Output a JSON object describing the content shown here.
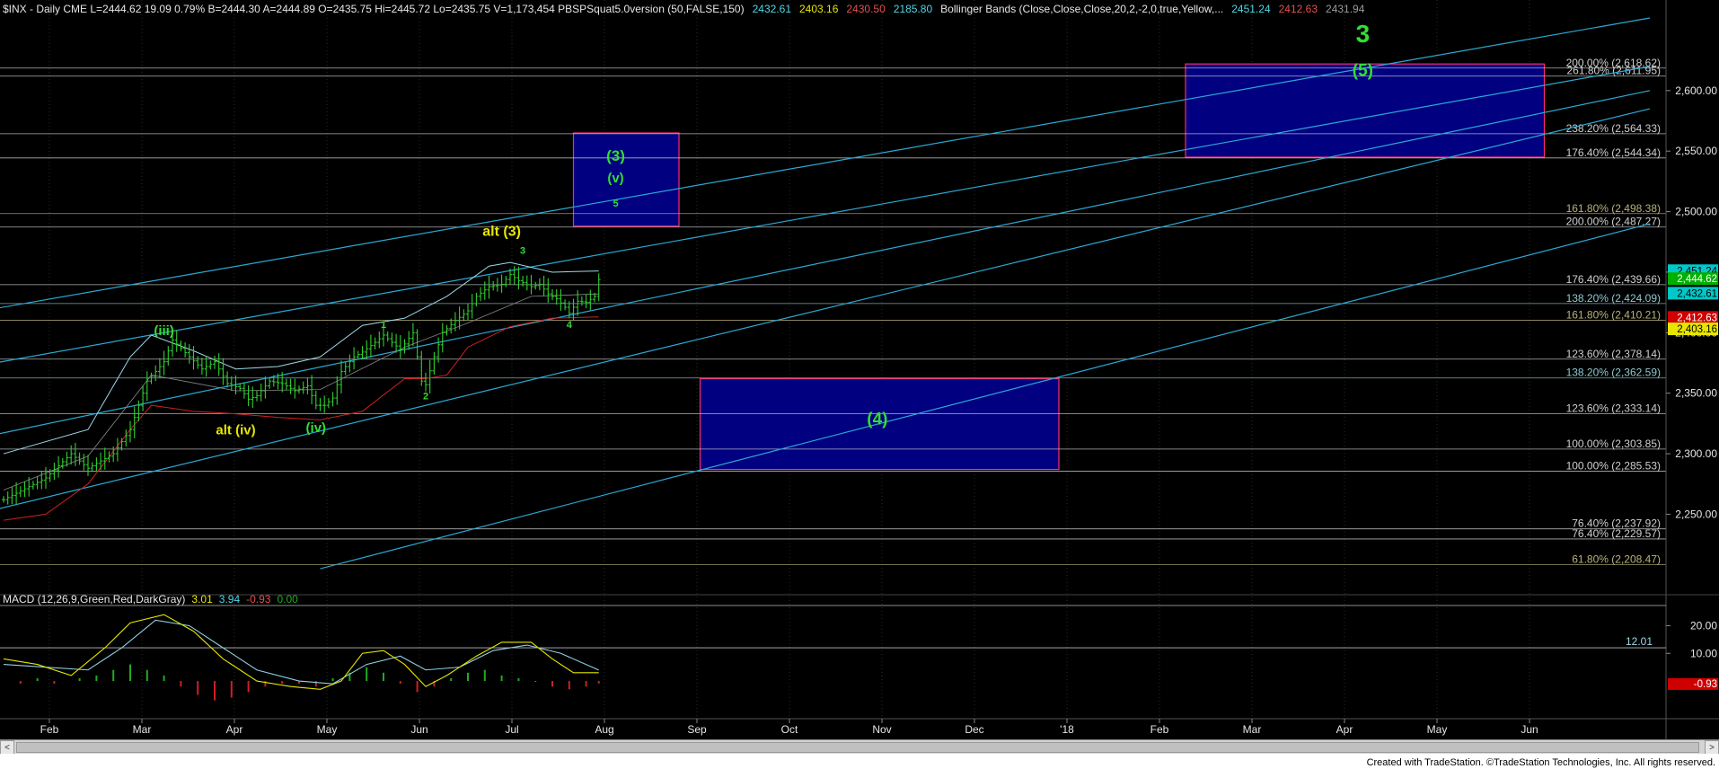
{
  "header": {
    "parts": [
      {
        "text": "$INX - Daily  CME   L=2444.62  19.09  0.79%   B=2444.30   A=2444.89   O=2435.75   Hi=2445.72   Lo=2435.75   V=1,173,454   PBSPSquat5.0version (50,FALSE,150)",
        "color": "#e6e6e6"
      },
      {
        "text": "2432.61",
        "color": "#4fd6e6"
      },
      {
        "text": "2403.16",
        "color": "#e6e600"
      },
      {
        "text": "2430.50",
        "color": "#e05050"
      },
      {
        "text": "2185.80",
        "color": "#4fd6e6"
      },
      {
        "text": "Bollinger Bands (Close,Close,Close,20,2,-2,0,true,Yellow,...",
        "color": "#e6e6e6"
      },
      {
        "text": "2451.24",
        "color": "#4fd6e6"
      },
      {
        "text": "2412.63",
        "color": "#e05050"
      },
      {
        "text": "2431.94",
        "color": "#9a9a9a"
      }
    ]
  },
  "macd_header": {
    "parts": [
      {
        "text": "MACD (12,26,9,Green,Red,DarkGray)",
        "color": "#e6e6e6"
      },
      {
        "text": "3.01",
        "color": "#e6e600"
      },
      {
        "text": "3.94",
        "color": "#4fd6e6"
      },
      {
        "text": "-0.93",
        "color": "#e05050"
      },
      {
        "text": "0.00",
        "color": "#22aa22"
      }
    ]
  },
  "footer": {
    "credit": "Created with TradeStation. ©TradeStation Technologies, Inc. All rights reserved."
  },
  "chart_data": [
    {
      "type": "candlestick",
      "symbol": "$INX",
      "timeframe": "Daily",
      "ylim": [
        2185,
        2660
      ],
      "y_ticks": [
        2250,
        2300,
        2350,
        2400,
        2450,
        2500,
        2550,
        2600
      ],
      "x_ticks": [
        "Feb",
        "Mar",
        "Apr",
        "May",
        "Jun",
        "Jul",
        "Aug",
        "Sep",
        "Oct",
        "Nov",
        "Dec",
        "'18",
        "Feb",
        "Mar",
        "Apr",
        "May",
        "Jun"
      ],
      "last_price": 2444.62,
      "price_path": [
        [
          0,
          2262
        ],
        [
          10,
          2280
        ],
        [
          16,
          2300
        ],
        [
          20,
          2288
        ],
        [
          26,
          2300
        ],
        [
          30,
          2320
        ],
        [
          34,
          2360
        ],
        [
          38,
          2376
        ],
        [
          40,
          2394
        ],
        [
          44,
          2380
        ],
        [
          47,
          2370
        ],
        [
          50,
          2376
        ],
        [
          53,
          2358
        ],
        [
          56,
          2354
        ],
        [
          58,
          2345
        ],
        [
          60,
          2348
        ],
        [
          63,
          2360
        ],
        [
          66,
          2358
        ],
        [
          69,
          2352
        ],
        [
          72,
          2356
        ],
        [
          74,
          2340
        ],
        [
          76,
          2340
        ],
        [
          78,
          2346
        ],
        [
          80,
          2368
        ],
        [
          83,
          2380
        ],
        [
          85,
          2384
        ],
        [
          88,
          2392
        ],
        [
          90,
          2398
        ],
        [
          92,
          2392
        ],
        [
          94,
          2386
        ],
        [
          97,
          2400
        ],
        [
          99,
          2360
        ],
        [
          100,
          2357
        ],
        [
          102,
          2380
        ],
        [
          104,
          2400
        ],
        [
          107,
          2410
        ],
        [
          110,
          2418
        ],
        [
          112,
          2430
        ],
        [
          115,
          2438
        ],
        [
          118,
          2440
        ],
        [
          120,
          2448
        ],
        [
          122,
          2443
        ],
        [
          125,
          2438
        ],
        [
          127,
          2440
        ],
        [
          129,
          2432
        ],
        [
          131,
          2428
        ],
        [
          133,
          2421
        ],
        [
          134,
          2416
        ],
        [
          136,
          2426
        ],
        [
          138,
          2425
        ],
        [
          140,
          2430
        ],
        [
          141,
          2444
        ]
      ],
      "bollinger_upper": [
        [
          0,
          2300
        ],
        [
          20,
          2320
        ],
        [
          30,
          2380
        ],
        [
          35,
          2398
        ],
        [
          45,
          2385
        ],
        [
          55,
          2370
        ],
        [
          65,
          2372
        ],
        [
          75,
          2380
        ],
        [
          85,
          2406
        ],
        [
          95,
          2412
        ],
        [
          105,
          2430
        ],
        [
          115,
          2455
        ],
        [
          120,
          2458
        ],
        [
          130,
          2450
        ],
        [
          141,
          2451
        ]
      ],
      "bollinger_lower": [
        [
          0,
          2245
        ],
        [
          10,
          2250
        ],
        [
          20,
          2275
        ],
        [
          30,
          2320
        ],
        [
          35,
          2340
        ],
        [
          45,
          2335
        ],
        [
          55,
          2333
        ],
        [
          65,
          2330
        ],
        [
          75,
          2328
        ],
        [
          85,
          2335
        ],
        [
          95,
          2362
        ],
        [
          100,
          2362
        ],
        [
          105,
          2365
        ],
        [
          110,
          2388
        ],
        [
          120,
          2405
        ],
        [
          130,
          2412
        ],
        [
          141,
          2413
        ]
      ],
      "bollinger_mid": [
        [
          0,
          2270
        ],
        [
          20,
          2298
        ],
        [
          35,
          2365
        ],
        [
          55,
          2352
        ],
        [
          75,
          2353
        ],
        [
          95,
          2388
        ],
        [
          110,
          2408
        ],
        [
          125,
          2430
        ],
        [
          141,
          2432
        ]
      ],
      "channel_lines": [
        {
          "p1": [
            -10,
            2415
          ],
          "p2": [
            390,
            2660
          ]
        },
        {
          "p1": [
            -10,
            2370
          ],
          "p2": [
            390,
            2620
          ]
        },
        {
          "p1": [
            -10,
            2310
          ],
          "p2": [
            390,
            2600
          ]
        },
        {
          "p1": [
            -10,
            2247
          ],
          "p2": [
            390,
            2585
          ]
        },
        {
          "p1": [
            75,
            2205
          ],
          "p2": [
            390,
            2490
          ]
        }
      ],
      "boxes": [
        {
          "x": [
            135,
            160
          ],
          "y": [
            2488,
            2565
          ],
          "label": "(3) (v) 5"
        },
        {
          "x": [
            165,
            250
          ],
          "y": [
            2287,
            2362
          ],
          "label": "(4)"
        },
        {
          "x": [
            280,
            365
          ],
          "y": [
            2545,
            2622
          ],
          "label": "3 (5)"
        }
      ],
      "fib_levels": [
        {
          "value": 2618.62,
          "label": "200.00% (2,618.62)",
          "color": "#cfcfcf"
        },
        {
          "value": 2611.95,
          "label": "261.80% (2,611.95)",
          "color": "#cfcfcf"
        },
        {
          "value": 2564.33,
          "label": "238.20% (2,564.33)",
          "color": "#cfcfcf"
        },
        {
          "value": 2544.34,
          "label": "176.40% (2,544.34)",
          "color": "#cfcfcf"
        },
        {
          "value": 2498.38,
          "label": "161.80% (2,498.38)",
          "color": "#b8b27a"
        },
        {
          "value": 2487.27,
          "label": "200.00% (2,487.27)",
          "color": "#cfcfcf"
        },
        {
          "value": 2439.66,
          "label": "176.40% (2,439.66)",
          "color": "#cfcfcf"
        },
        {
          "value": 2424.09,
          "label": "138.20% (2,424.09)",
          "color": "#8fc8d0"
        },
        {
          "value": 2410.21,
          "label": "161.80% (2,410.21)",
          "color": "#b8b27a"
        },
        {
          "value": 2378.14,
          "label": "123.60% (2,378.14)",
          "color": "#cfcfcf"
        },
        {
          "value": 2362.59,
          "label": "138.20% (2,362.59)",
          "color": "#8fc8d0"
        },
        {
          "value": 2333.14,
          "label": "123.60% (2,333.14)",
          "color": "#cfcfcf"
        },
        {
          "value": 2303.85,
          "label": "100.00% (2,303.85)",
          "color": "#cfcfcf"
        },
        {
          "value": 2285.53,
          "label": "100.00% (2,285.53)",
          "color": "#cfcfcf"
        },
        {
          "value": 2237.92,
          "label": "76.40% (2,237.92)",
          "color": "#cfcfcf"
        },
        {
          "value": 2229.57,
          "label": "76.40% (2,229.57)",
          "color": "#cfcfcf"
        },
        {
          "value": 2208.47,
          "label": "61.80% (2,208.47)",
          "color": "#b8b27a"
        }
      ],
      "price_tags": [
        {
          "text": "2,451.24",
          "value": 2451.24,
          "bg": "#00c8c8",
          "fg": "#000000"
        },
        {
          "text": "2,444.62",
          "value": 2444.62,
          "bg": "#00b000",
          "fg": "#ffffff"
        },
        {
          "text": "2,432.61",
          "value": 2432.61,
          "bg": "#00c8c8",
          "fg": "#000000"
        },
        {
          "text": "2,412.63",
          "value": 2412.63,
          "bg": "#d00000",
          "fg": "#ffffff"
        },
        {
          "text": "2,403.16",
          "value": 2403.16,
          "bg": "#e6e600",
          "fg": "#000000"
        }
      ],
      "wave_labels": [
        {
          "text": "(iii)",
          "x": 38,
          "y": 2398,
          "color": "#33dd33",
          "size": 15
        },
        {
          "text": "alt (iv)",
          "x": 55,
          "y": 2316,
          "color": "#e6e600",
          "size": 15
        },
        {
          "text": "(iv)",
          "x": 74,
          "y": 2318,
          "color": "#33dd33",
          "size": 15
        },
        {
          "text": "1",
          "x": 90,
          "y": 2404,
          "color": "#33dd33",
          "size": 11
        },
        {
          "text": "2",
          "x": 100,
          "y": 2345,
          "color": "#33dd33",
          "size": 11
        },
        {
          "text": "alt (3)",
          "x": 118,
          "y": 2480,
          "color": "#e6e600",
          "size": 16
        },
        {
          "text": "3",
          "x": 123,
          "y": 2465,
          "color": "#33dd33",
          "size": 11
        },
        {
          "text": "4",
          "x": 134,
          "y": 2404,
          "color": "#33dd33",
          "size": 11
        },
        {
          "text": "(3)",
          "x": 145,
          "y": 2542,
          "color": "#33dd33",
          "size": 17
        },
        {
          "text": "(v)",
          "x": 145,
          "y": 2524,
          "color": "#33dd33",
          "size": 15
        },
        {
          "text": "5",
          "x": 145,
          "y": 2504,
          "color": "#33dd33",
          "size": 11
        },
        {
          "text": "(4)",
          "x": 207,
          "y": 2324,
          "color": "#33dd33",
          "size": 19
        },
        {
          "text": "3",
          "x": 322,
          "y": 2640,
          "color": "#33dd33",
          "size": 28
        },
        {
          "text": "(5)",
          "x": 322,
          "y": 2612,
          "color": "#33dd33",
          "size": 19
        }
      ]
    },
    {
      "type": "macd",
      "title": "MACD (12,26,9,Green,Red,DarkGray)",
      "ylim": [
        -12,
        26
      ],
      "y_ticks": [
        20,
        10
      ],
      "reference_line": {
        "value": 12.01,
        "label": "12.01"
      },
      "last_histogram_tag": "-0.93",
      "macd": [
        [
          0,
          8
        ],
        [
          8,
          6
        ],
        [
          16,
          2
        ],
        [
          24,
          12
        ],
        [
          30,
          21
        ],
        [
          38,
          24
        ],
        [
          45,
          18
        ],
        [
          52,
          8
        ],
        [
          60,
          0
        ],
        [
          68,
          -2
        ],
        [
          75,
          -3
        ],
        [
          80,
          0
        ],
        [
          85,
          10
        ],
        [
          90,
          11
        ],
        [
          95,
          6
        ],
        [
          100,
          -2
        ],
        [
          105,
          2
        ],
        [
          112,
          9
        ],
        [
          118,
          14
        ],
        [
          125,
          14
        ],
        [
          130,
          8
        ],
        [
          135,
          3
        ],
        [
          141,
          3.01
        ]
      ],
      "signal": [
        [
          0,
          6
        ],
        [
          10,
          5
        ],
        [
          20,
          4
        ],
        [
          28,
          12
        ],
        [
          36,
          22
        ],
        [
          44,
          20
        ],
        [
          52,
          12
        ],
        [
          60,
          4
        ],
        [
          70,
          0
        ],
        [
          78,
          -1
        ],
        [
          86,
          6
        ],
        [
          94,
          9
        ],
        [
          100,
          4
        ],
        [
          108,
          5
        ],
        [
          116,
          11
        ],
        [
          124,
          13
        ],
        [
          132,
          10
        ],
        [
          141,
          3.94
        ]
      ],
      "histogram": [
        [
          4,
          -1
        ],
        [
          8,
          1
        ],
        [
          12,
          -1
        ],
        [
          18,
          1
        ],
        [
          22,
          2
        ],
        [
          26,
          4
        ],
        [
          30,
          6
        ],
        [
          34,
          4
        ],
        [
          38,
          2
        ],
        [
          42,
          -2
        ],
        [
          46,
          -5
        ],
        [
          50,
          -7
        ],
        [
          54,
          -6
        ],
        [
          58,
          -4
        ],
        [
          62,
          -2
        ],
        [
          66,
          -1
        ],
        [
          70,
          -1
        ],
        [
          74,
          -2
        ],
        [
          78,
          1
        ],
        [
          82,
          3
        ],
        [
          86,
          5
        ],
        [
          90,
          3
        ],
        [
          94,
          -1
        ],
        [
          98,
          -4
        ],
        [
          102,
          -2
        ],
        [
          106,
          1
        ],
        [
          110,
          3
        ],
        [
          114,
          4
        ],
        [
          118,
          2
        ],
        [
          122,
          1
        ],
        [
          126,
          0
        ],
        [
          130,
          -2
        ],
        [
          134,
          -3
        ],
        [
          138,
          -2
        ],
        [
          141,
          -0.93
        ]
      ]
    }
  ],
  "axis": {
    "right_label_color": "#e6e6e6",
    "grid_color": "#2a2a2a"
  },
  "scroll": {
    "left_arrow": "<",
    "right_arrow": ">"
  }
}
